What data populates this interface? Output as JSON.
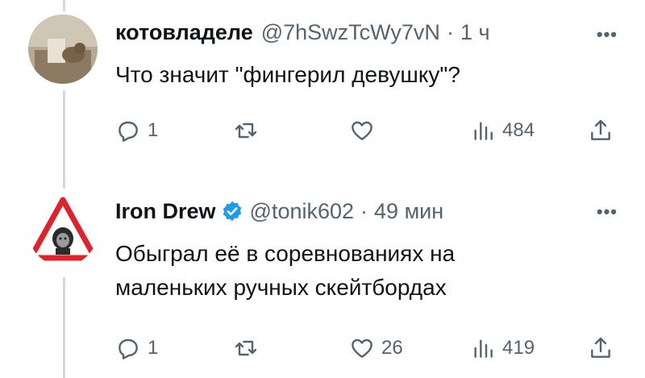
{
  "tweets": [
    {
      "name": "котовладеле",
      "handle": "@7hSwzTcWy7vN",
      "separator": "·",
      "time": "1 ч",
      "more": "•••",
      "text": "Что значит \"фингерил девушку\"?",
      "replies": "1",
      "retweets": "",
      "likes": "",
      "views": "484"
    },
    {
      "name": "Iron Drew",
      "handle": "@tonik602",
      "separator": "·",
      "time": "49 мин",
      "more": "•••",
      "text_line1": "Обыграл её в соревнованиях на",
      "text_line2": "маленьких ручных скейтбордах",
      "replies": "1",
      "retweets": "",
      "likes": "26",
      "views": "419",
      "verified": true
    }
  ],
  "colors": {
    "text": "#0f1419",
    "muted": "#536471",
    "verified": "#1d9bf0",
    "thread_line": "#cfd9de"
  }
}
